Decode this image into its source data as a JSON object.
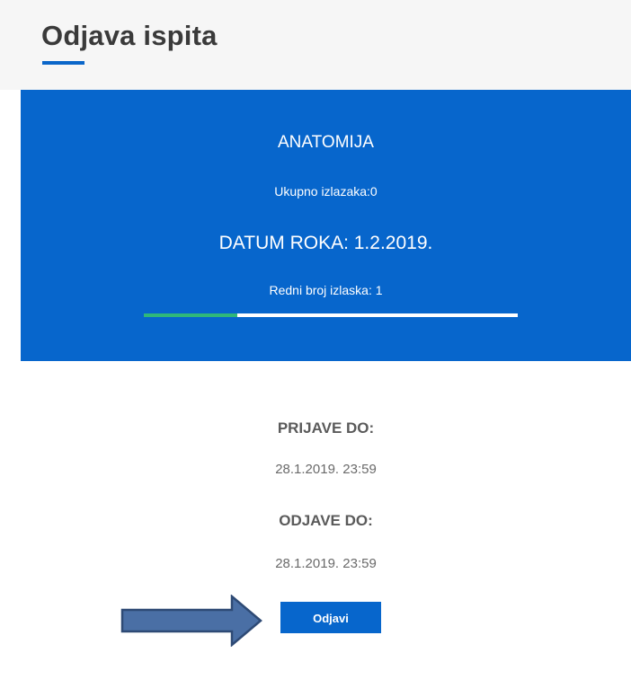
{
  "header": {
    "title": "Odjava ispita",
    "accent_color": "#0a66c9"
  },
  "exam_card": {
    "course_name": "ANATOMIJA",
    "total_attempts": "Ukupno izlazaka:0",
    "exam_date": "DATUM ROKA: 1.2.2019.",
    "attempt_number": "Redni broj izlaska: 1",
    "progress_fraction": 0.25,
    "background_color": "#0766cc",
    "progress_color": "#2fb87a"
  },
  "deadlines": {
    "registration_label": "PRIJAVE DO:",
    "registration_value": "28.1.2019. 23:59",
    "deregistration_label": "ODJAVE DO:",
    "deregistration_value": "28.1.2019. 23:59"
  },
  "actions": {
    "deregister_label": "Odjavi"
  },
  "annotation": {
    "icon": "right-arrow-icon",
    "color": "#4a6fa5"
  }
}
